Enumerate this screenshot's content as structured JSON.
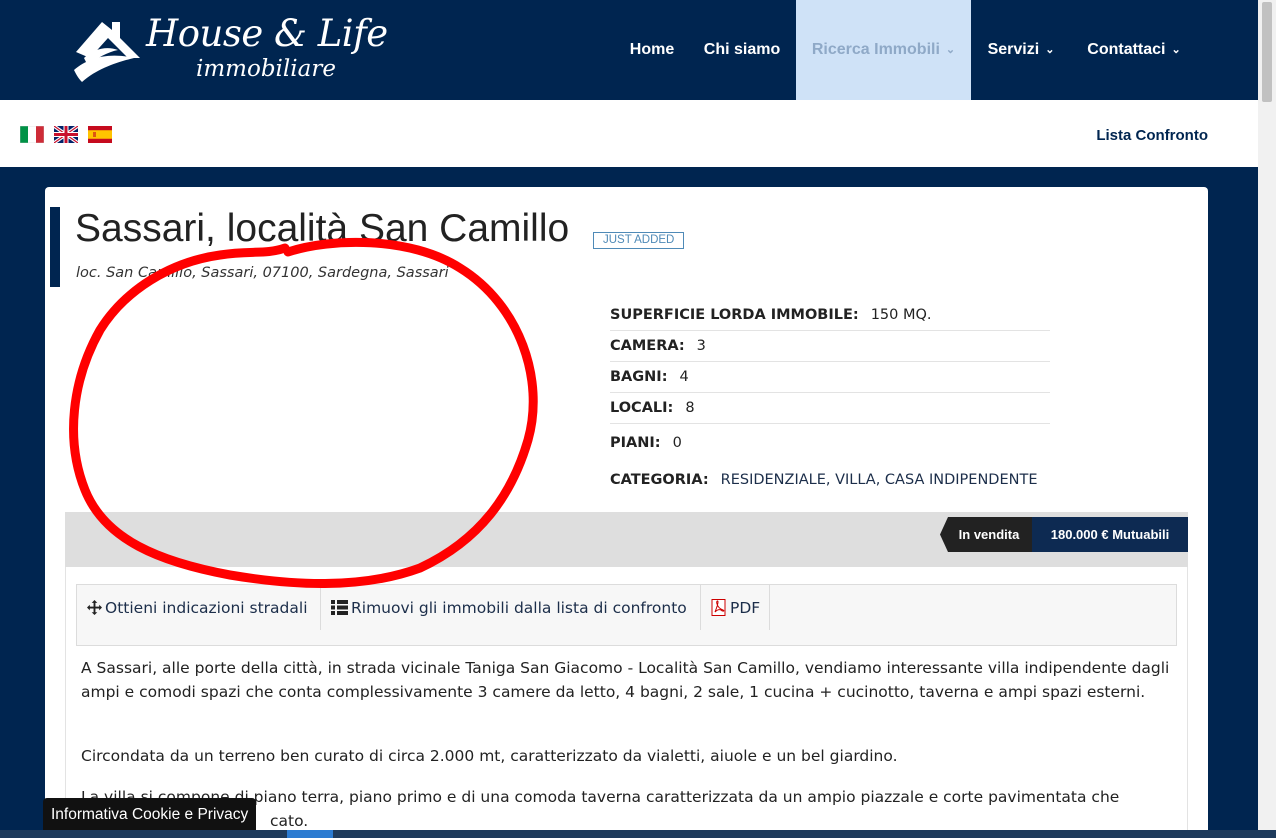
{
  "brand": {
    "title": "House & Life",
    "subtitle": "immobiliare"
  },
  "nav": {
    "items": [
      {
        "label": "Home",
        "dropdown": false,
        "active": false
      },
      {
        "label": "Chi siamo",
        "dropdown": false,
        "active": false
      },
      {
        "label": "Ricerca Immobili",
        "dropdown": true,
        "active": true
      },
      {
        "label": "Servizi",
        "dropdown": true,
        "active": false
      },
      {
        "label": "Contattaci",
        "dropdown": true,
        "active": false
      }
    ]
  },
  "languages": [
    "italian-flag",
    "english-flag",
    "spanish-flag"
  ],
  "compare_link": "Lista Confronto",
  "listing": {
    "title": "Sassari, località San Camillo",
    "badge": "JUST ADDED",
    "address": "loc. San Camillo, Sassari, 07100, Sardegna, Sassari",
    "specs": [
      {
        "key": "SUPERFICIE LORDA IMMOBILE:",
        "value": "150 MQ."
      },
      {
        "key": "CAMERA:",
        "value": "3"
      },
      {
        "key": "BAGNI:",
        "value": "4"
      },
      {
        "key": "LOCALI:",
        "value": "8"
      },
      {
        "key": "PIANI:",
        "value": "0"
      },
      {
        "key": "CATEGORIA:",
        "value": "RESIDENZIALE, VILLA, CASA INDIPENDENTE"
      }
    ],
    "status": "In vendita",
    "price": "180.000 € Mutuabili",
    "actions": [
      {
        "label": "Ottieni indicazioni stradali",
        "icon": "move-arrows-icon"
      },
      {
        "label": "Rimuovi gli immobili dalla lista di confronto",
        "icon": "list-icon"
      },
      {
        "label": "PDF",
        "icon": "pdf-icon"
      }
    ],
    "description": [
      "A Sassari, alle porte della città, in strada vicinale Taniga San Giacomo - Località San Camillo, vendiamo interessante villa indipendente dagli ampi e comodi spazi che conta complessivamente 3 camere da letto, 4 bagni, 2 sale, 1 cucina + cucinotto, taverna e ampi spazi esterni.",
      "Circondata da un terreno ben curato di circa 2.000 mt, caratterizzato da vialetti, aiuole e un bel giardino.",
      "La villa si compone di piano terra, piano primo e di una comoda taverna caratterizzata da un ampio piazzale e corte pavimentata che",
      "cato."
    ]
  },
  "cookie_banner": "Informativa Cookie e Privacy",
  "annotation": {
    "color": "#ff0000"
  },
  "colors": {
    "navy": "#002550",
    "nav_active_bg": "#cfe2f7",
    "price_bg": "#0d2a52"
  }
}
